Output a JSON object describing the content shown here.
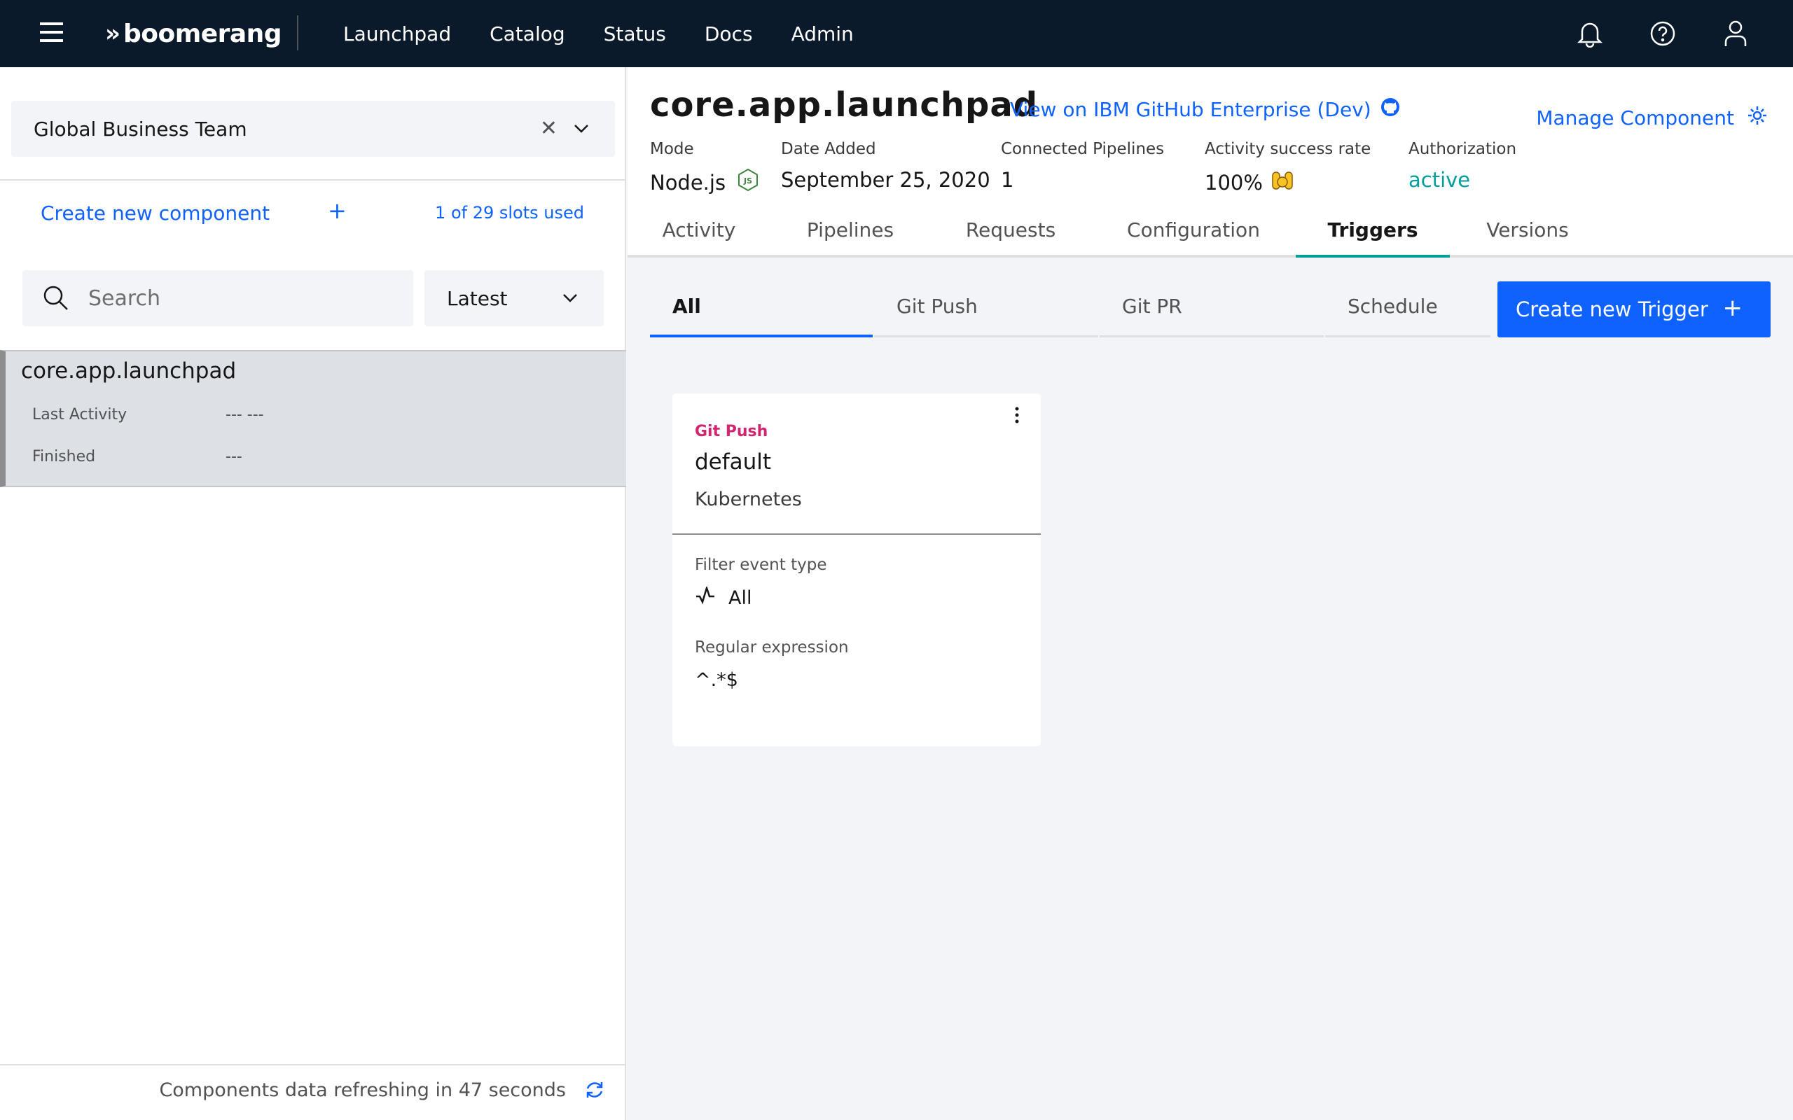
{
  "topbar": {
    "brand": "boomerang",
    "nav": [
      "Launchpad",
      "Catalog",
      "Status",
      "Docs",
      "Admin"
    ],
    "icons": [
      "bell-icon",
      "help-icon",
      "user-icon"
    ]
  },
  "sidebar": {
    "team_select": "Global Business Team",
    "create_component": "Create new component",
    "plus": "+",
    "slots": "1 of 29 slots used",
    "search_placeholder": "Search",
    "sort": "Latest",
    "components": [
      {
        "name": "core.app.launchpad",
        "last_activity_label": "Last Activity",
        "last_activity_value": "--- ---",
        "finished_label": "Finished",
        "finished_value": "---"
      }
    ],
    "refresh_text": "Components data refreshing in 47 seconds"
  },
  "header": {
    "component_name": "core.app.launchpad",
    "github_link": "View on IBM GitHub Enterprise (Dev)",
    "manage": "Manage Component",
    "meta": {
      "mode_label": "Mode",
      "mode_value": "Node.js",
      "date_label": "Date Added",
      "date_value": "September 25, 2020",
      "pipelines_label": "Connected Pipelines",
      "pipelines_value": "1",
      "success_label": "Activity success rate",
      "success_value": "100%",
      "auth_label": "Authorization",
      "auth_value": "active"
    }
  },
  "tabs": [
    "Activity",
    "Pipelines",
    "Requests",
    "Configuration",
    "Triggers",
    "Versions"
  ],
  "selected_tab": "Triggers",
  "subtabs": [
    "All",
    "Git Push",
    "Git PR",
    "Schedule"
  ],
  "create_trigger": "Create new Trigger",
  "trigger_card": {
    "type": "Git Push",
    "name": "default",
    "provider": "Kubernetes",
    "filter_label": "Filter event type",
    "filter_value": "All",
    "regex_label": "Regular expression",
    "regex_value": "^.*$"
  },
  "colors": {
    "accent": "#0f62fe",
    "teal": "#009d9a",
    "magenta": "#d02670",
    "topbar": "#0b1a2b"
  }
}
